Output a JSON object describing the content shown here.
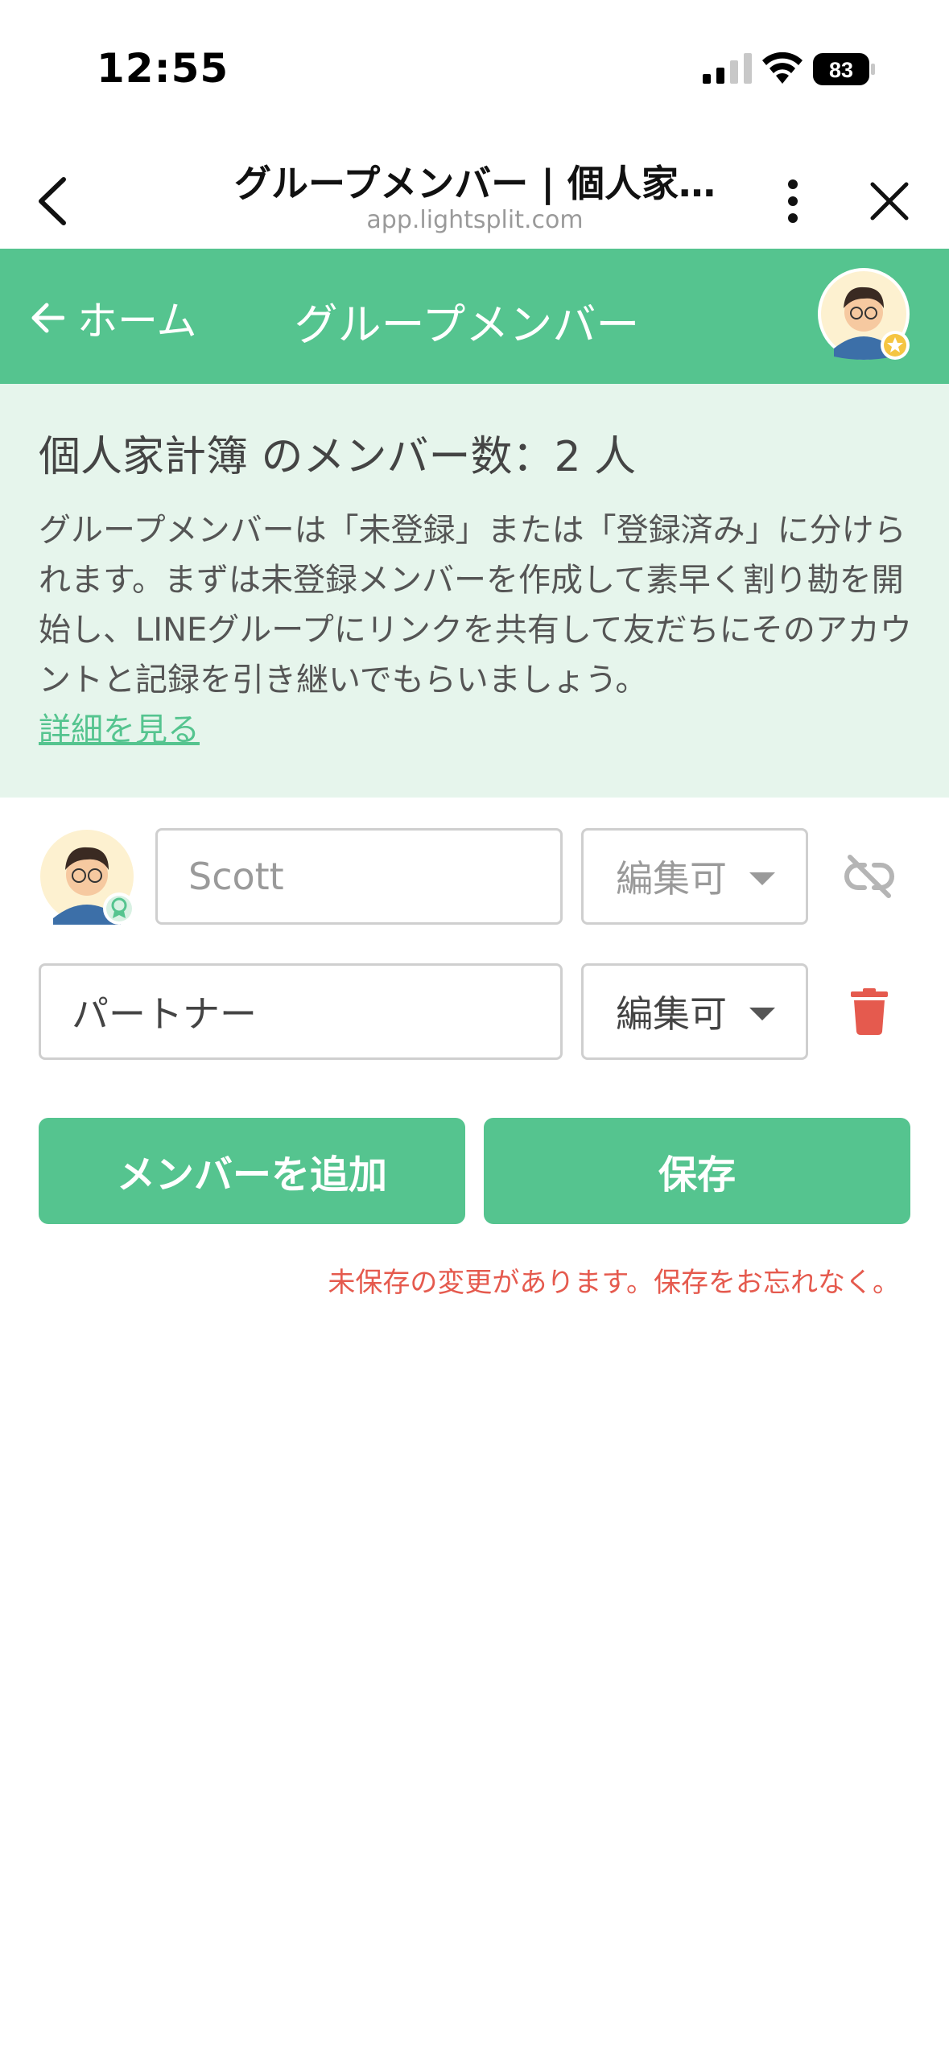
{
  "status_bar": {
    "time": "12:55",
    "battery": "83"
  },
  "browser": {
    "title": "グループメンバー | 個人家…",
    "url": "app.lightsplit.com"
  },
  "header": {
    "home_label": "ホーム",
    "title": "グループメンバー"
  },
  "info": {
    "member_count": "個人家計簿 のメンバー数：2 人",
    "description": "グループメンバーは「未登録」または「登録済み」に分けられます。まずは未登録メンバーを作成して素早く割り勘を開始し、LINEグループにリンクを共有して友だちにそのアカウントと記録を引き継いでもらいましょう。",
    "details_link": "詳細を見る"
  },
  "members": [
    {
      "name": "Scott",
      "permission": "編集可"
    },
    {
      "name": "パートナー",
      "permission": "編集可"
    }
  ],
  "buttons": {
    "add_member": "メンバーを追加",
    "save": "保存"
  },
  "unsaved_message": "未保存の変更があります。保存をお忘れなく。",
  "colors": {
    "accent": "#55c48f",
    "info_bg": "#e6f5ec",
    "danger": "#e55a4e"
  }
}
